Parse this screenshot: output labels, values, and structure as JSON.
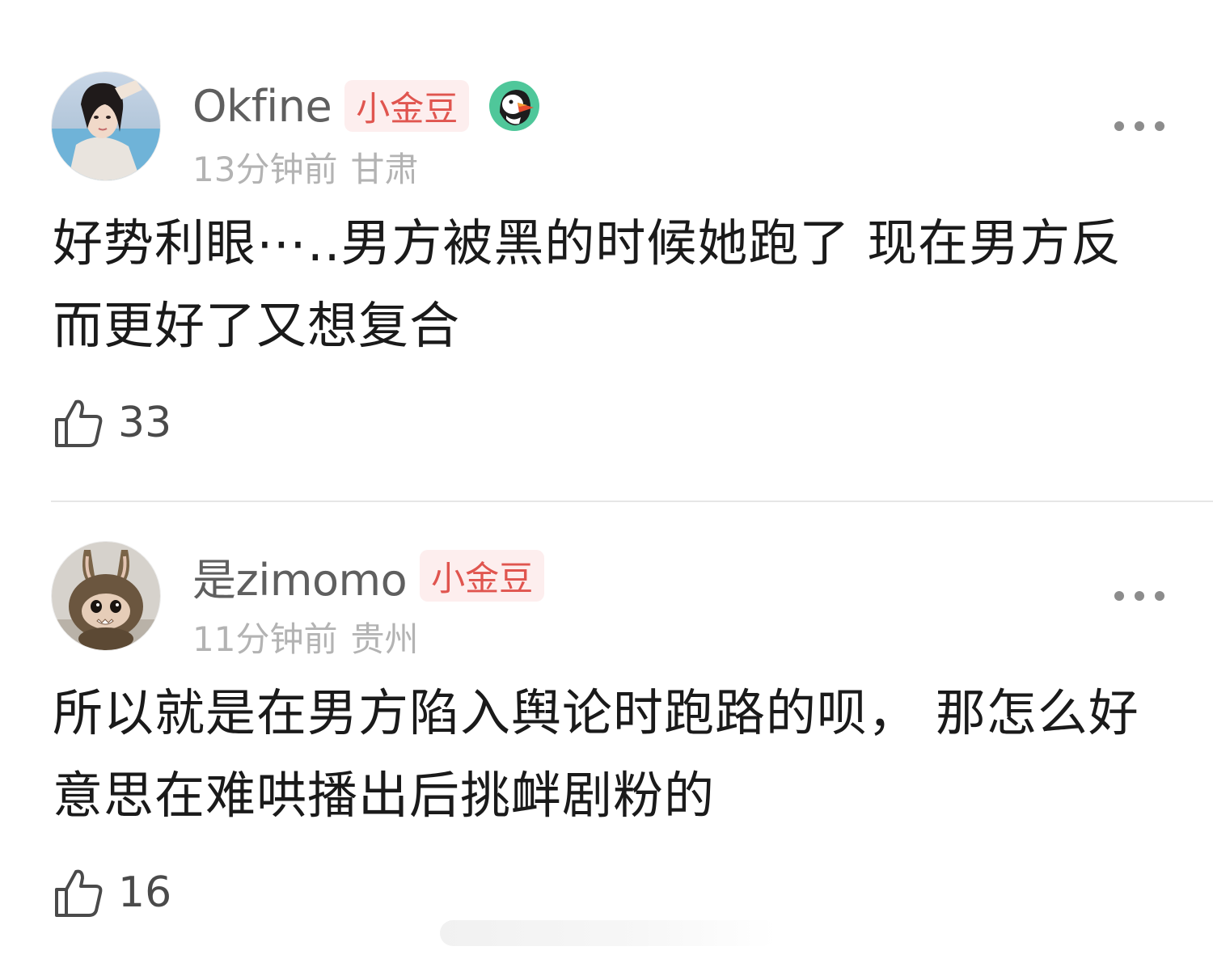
{
  "comments": [
    {
      "username": "Okfine",
      "badge": "小金豆",
      "time": "13分钟前",
      "location": "甘肃",
      "text": "好势利眼⋯..男方被黑的时候她跑了 现在男方反而更好了又想复合",
      "likes": "33",
      "avatar_icon": "woman-photo-avatar",
      "extra_icon": "puffin-icon"
    },
    {
      "username": "是zimomo",
      "badge": "小金豆",
      "time": "11分钟前",
      "location": "贵州",
      "text": "所以就是在男方陷入舆论时跑路的呗， 那怎么好意思在难哄播出后挑衅剧粉的",
      "likes": "16",
      "avatar_icon": "plush-toy-avatar"
    }
  ],
  "colors": {
    "badge_bg": "#fdeeee",
    "badge_text": "#e0554f",
    "username": "#5f5f5f",
    "meta": "#b3b3b3",
    "body_text": "#1a1a1a"
  }
}
